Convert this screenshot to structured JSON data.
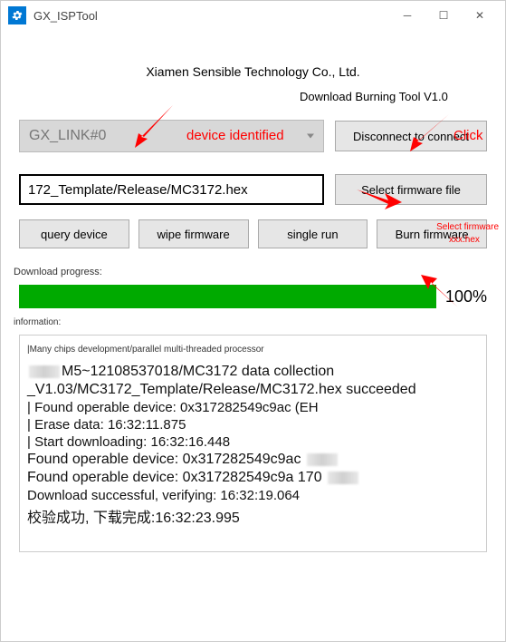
{
  "window": {
    "title": "GX_ISPTool"
  },
  "header": {
    "company": "Xiamen Sensible Technology Co., Ltd.",
    "tool_label": "Download Burning Tool V1.0"
  },
  "device": {
    "selected": "GX_LINK#0",
    "connect_btn": "Disconnect to connect"
  },
  "firmware": {
    "path_display": "172_Template/Release/MC3172.hex",
    "select_btn": "Select firmware file"
  },
  "actions": {
    "query": "query device",
    "wipe": "wipe firmware",
    "single": "single run",
    "burn": "Burn firmware"
  },
  "progress": {
    "label": "Download progress:",
    "percent_text": "100%",
    "percent_value": 100
  },
  "info_label": "information:",
  "log": {
    "header_small": "|Many chips development/parallel multi-threaded processor",
    "lines": [
      "M5~12108537018/MC3172 data collection",
      "_V1.03/MC3172_Template/Release/MC3172.hex succeeded",
      "| Found operable device: 0x317282549c9ac (EH",
      "| Erase data: 16:32:11.875",
      "| Start downloading: 16:32:16.448",
      "Found operable device: 0x317282549c9ac",
      " Found operable device: 0x317282549c9a 170",
      " Download successful, verifying: 16:32:19.064",
      " 校验成功, 下载完成:16:32:23.995"
    ]
  },
  "annotations": {
    "device_identified": "device identified",
    "click": "Click",
    "select_firmware": "Select firmware",
    "hex_hint": "xxx.hex"
  }
}
